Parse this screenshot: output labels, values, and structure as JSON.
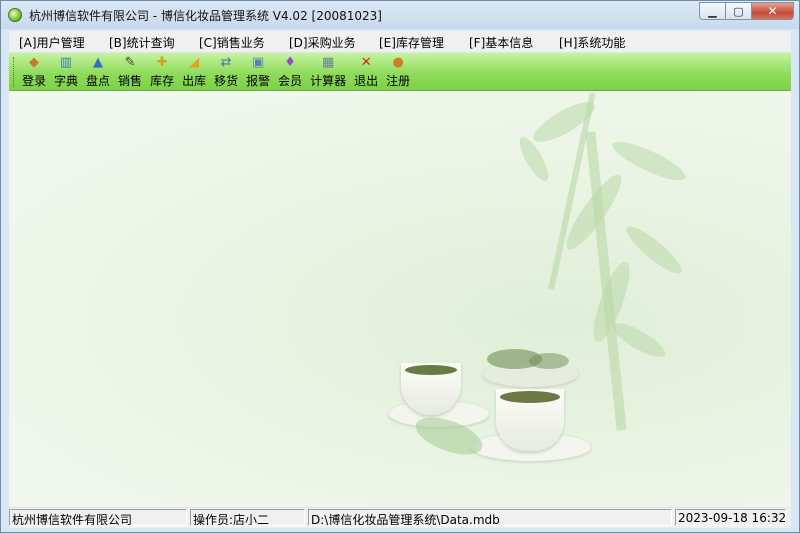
{
  "window": {
    "title": "杭州博信软件有限公司 - 博信化妆品管理系统 V4.02 [20081023]",
    "caption_buttons": [
      "minimize",
      "maximize",
      "close"
    ]
  },
  "menubar": {
    "items": [
      "[A]用户管理",
      "[B]统计查询",
      "[C]销售业务",
      "[D]采购业务",
      "[E]库存管理",
      "[F]基本信息",
      "[H]系统功能"
    ]
  },
  "toolbar": {
    "items": [
      {
        "label": "登录",
        "icon": "login-icon",
        "color": "#c77a2b"
      },
      {
        "label": "字典",
        "icon": "dictionary-icon",
        "color": "#3d7bd0"
      },
      {
        "label": "盘点",
        "icon": "inventory-check-icon",
        "color": "#2f6fc4"
      },
      {
        "label": "销售",
        "icon": "sales-icon",
        "color": "#444444"
      },
      {
        "label": "库存",
        "icon": "stock-icon",
        "color": "#d0a21f"
      },
      {
        "label": "出库",
        "icon": "outbound-icon",
        "color": "#e2a21e"
      },
      {
        "label": "移货",
        "icon": "transfer-icon",
        "color": "#4670b8"
      },
      {
        "label": "报警",
        "icon": "alarm-icon",
        "color": "#5a82b5"
      },
      {
        "label": "会员",
        "icon": "member-icon",
        "color": "#9b4ad0"
      },
      {
        "label": "计算器",
        "icon": "calculator-icon",
        "color": "#6c7f98"
      },
      {
        "label": "退出",
        "icon": "exit-icon",
        "color": "#d6221b"
      },
      {
        "label": "注册",
        "icon": "register-icon",
        "color": "#cf7d27"
      }
    ]
  },
  "statusbar": {
    "company": "杭州博信软件有限公司",
    "operator": "操作员:店小二",
    "db_path": "D:\\博信化妆品管理系统\\Data.mdb",
    "datetime": "2023-09-18 16:32"
  }
}
